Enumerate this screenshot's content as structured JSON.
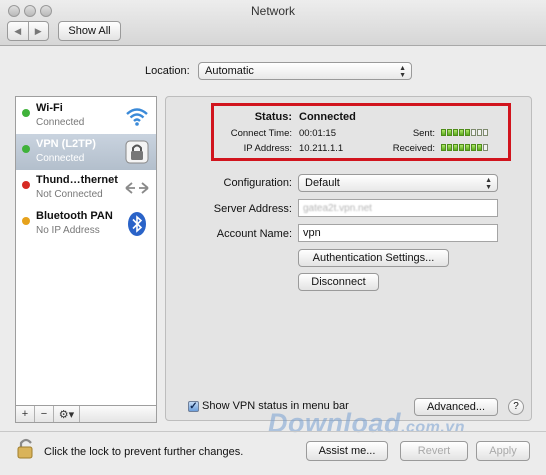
{
  "window": {
    "title": "Network"
  },
  "toolbar": {
    "back_glyph": "◀",
    "forward_glyph": "▶",
    "show_all_label": "Show All"
  },
  "location": {
    "label": "Location:",
    "value": "Automatic"
  },
  "sidebar": {
    "services": [
      {
        "name": "Wi-Fi",
        "status": "Connected",
        "dot_color": "#3fb23a",
        "icon": "wifi-icon"
      },
      {
        "name": "VPN (L2TP)",
        "status": "Connected",
        "dot_color": "#3fb23a",
        "icon": "lock-icon",
        "selected": true
      },
      {
        "name": "Thund…thernet",
        "status": "Not Connected",
        "dot_color": "#d62a23",
        "icon": "ethernet-arrows-icon"
      },
      {
        "name": "Bluetooth PAN",
        "status": "No IP Address",
        "dot_color": "#e6a21c",
        "icon": "bluetooth-icon"
      }
    ],
    "footer": {
      "add": "+",
      "remove": "−",
      "action": "⚙▾"
    }
  },
  "status": {
    "status_label": "Status:",
    "status_value": "Connected",
    "connect_time_label": "Connect Time:",
    "connect_time_value": "00:01:15",
    "ip_label": "IP Address:",
    "ip_value": "10.211.1.1",
    "sent_label": "Sent:",
    "received_label": "Received:",
    "sent_level": 0.62,
    "received_level": 0.88,
    "highlight_color": "#d1141d"
  },
  "config": {
    "configuration_label": "Configuration:",
    "configuration_value": "Default",
    "server_label": "Server Address:",
    "server_value": "gatea2t.vpn.net",
    "account_label": "Account Name:",
    "account_value": "vpn",
    "auth_button": "Authentication Settings...",
    "disconnect_button": "Disconnect"
  },
  "bottom": {
    "show_status_label": "Show VPN status in menu bar",
    "show_status_checked": true,
    "advanced_button": "Advanced...",
    "help_label": "?",
    "lock_text": "Click the lock to prevent further changes.",
    "assist_button": "Assist me...",
    "revert_button": "Revert",
    "apply_button": "Apply",
    "watermark": "Download",
    "watermark_tld": ".com.vn"
  }
}
